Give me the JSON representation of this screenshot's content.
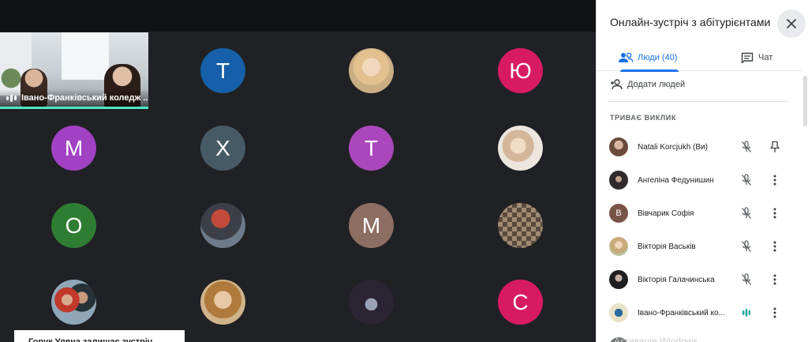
{
  "stage": {
    "featured": {
      "name": "Івано-Франківський коледж ...",
      "audio_active": true,
      "accent_color": "#4ee6c8"
    },
    "tiles": [
      {
        "type": "letter",
        "letter": "Т",
        "color": "#1560a8"
      },
      {
        "type": "photo",
        "icon": "photo-girl-blonde"
      },
      {
        "type": "letter",
        "letter": "Ю",
        "color": "#d81b60"
      },
      {
        "type": "letter",
        "letter": "М",
        "color": "#a142c4"
      },
      {
        "type": "letter",
        "letter": "Х",
        "color": "#455a64"
      },
      {
        "type": "letter",
        "letter": "Т",
        "color": "#ab47bc"
      },
      {
        "type": "photo",
        "icon": "photo-girl-light"
      },
      {
        "type": "letter",
        "letter": "О",
        "color": "#2e7d32"
      },
      {
        "type": "photo",
        "icon": "photo-anime-character"
      },
      {
        "type": "letter",
        "letter": "М",
        "color": "#8d6e63"
      },
      {
        "type": "photo",
        "icon": "photo-collage"
      },
      {
        "type": "photo",
        "icon": "photo-couple"
      },
      {
        "type": "photo",
        "icon": "photo-woman-glasses"
      },
      {
        "type": "photo",
        "icon": "photo-dark-illustration"
      },
      {
        "type": "letter",
        "letter": "С",
        "color": "#d81b60"
      }
    ],
    "toast": "Горук Уляна залишає зустріч"
  },
  "panel": {
    "title": "Онлайн-зустріч з абітурієнтами",
    "tabs": {
      "people_label": "Люди (40)",
      "chat_label": "Чат"
    },
    "add_people_label": "Додати людей",
    "section_heading": "ТРИВАЄ ВИКЛИК",
    "participants": [
      {
        "name": "Natali Korcjukh (Ви)",
        "avatar": "photo",
        "icon1": "mic-off-icon",
        "icon2": "pin-icon"
      },
      {
        "name": "Ангеліна Федунишин",
        "avatar": "photo",
        "icon1": "mic-off-icon",
        "icon2": "more-vert-icon"
      },
      {
        "name": "Вівчарик Софія",
        "avatar": "letter",
        "letter": "В",
        "color": "#795548",
        "icon1": "mic-off-icon",
        "icon2": "more-vert-icon"
      },
      {
        "name": "Вікторія Васьків",
        "avatar": "photo",
        "icon1": "mic-off-icon",
        "icon2": "more-vert-icon"
      },
      {
        "name": "Вікторія Галачинська",
        "avatar": "photo",
        "icon1": "mic-off-icon",
        "icon2": "more-vert-icon"
      },
      {
        "name": "Івано-Франківський ко...",
        "avatar": "photo",
        "icon1": "audio-active-icon",
        "icon2": "more-vert-icon"
      }
    ],
    "watermark": "Активація Windows"
  }
}
